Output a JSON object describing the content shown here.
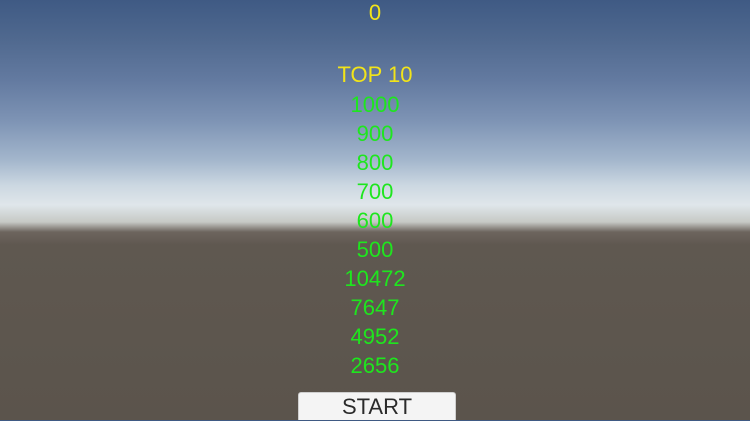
{
  "hud": {
    "score": "0"
  },
  "leaderboard": {
    "title": "TOP 10",
    "scores": [
      "1000",
      "900",
      "800",
      "700",
      "600",
      "500",
      "10472",
      "7647",
      "4952",
      "2656"
    ]
  },
  "start_button": {
    "label": "START"
  },
  "colors": {
    "title_yellow": "#f2e419",
    "score_green": "#1ee61e",
    "sky_top": "#3f5a84",
    "horizon": "#dfe6ea",
    "ground": "#5b544c"
  }
}
